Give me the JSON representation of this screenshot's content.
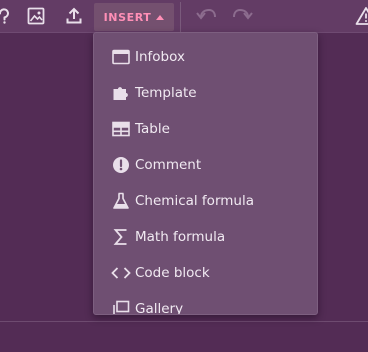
{
  "toolbar": {
    "insert_label": "INSERT",
    "icons": [
      "help-icon",
      "image-icon",
      "upload-icon",
      "undo-icon",
      "redo-icon",
      "warning-icon"
    ]
  },
  "insert_menu": {
    "items": [
      {
        "label": "Infobox",
        "icon": "infobox-icon"
      },
      {
        "label": "Template",
        "icon": "puzzle-icon"
      },
      {
        "label": "Table",
        "icon": "table-icon"
      },
      {
        "label": "Comment",
        "icon": "comment-icon"
      },
      {
        "label": "Chemical formula",
        "icon": "flask-icon"
      },
      {
        "label": "Math formula",
        "icon": "sigma-icon"
      },
      {
        "label": "Code block",
        "icon": "code-icon"
      },
      {
        "label": "Gallery",
        "icon": "gallery-icon"
      }
    ]
  },
  "colors": {
    "background": "#532c55",
    "toolbar": "#633c65",
    "menu": "#6f4f72",
    "accent": "#ff8fb6",
    "icon": "#e9dfea"
  }
}
